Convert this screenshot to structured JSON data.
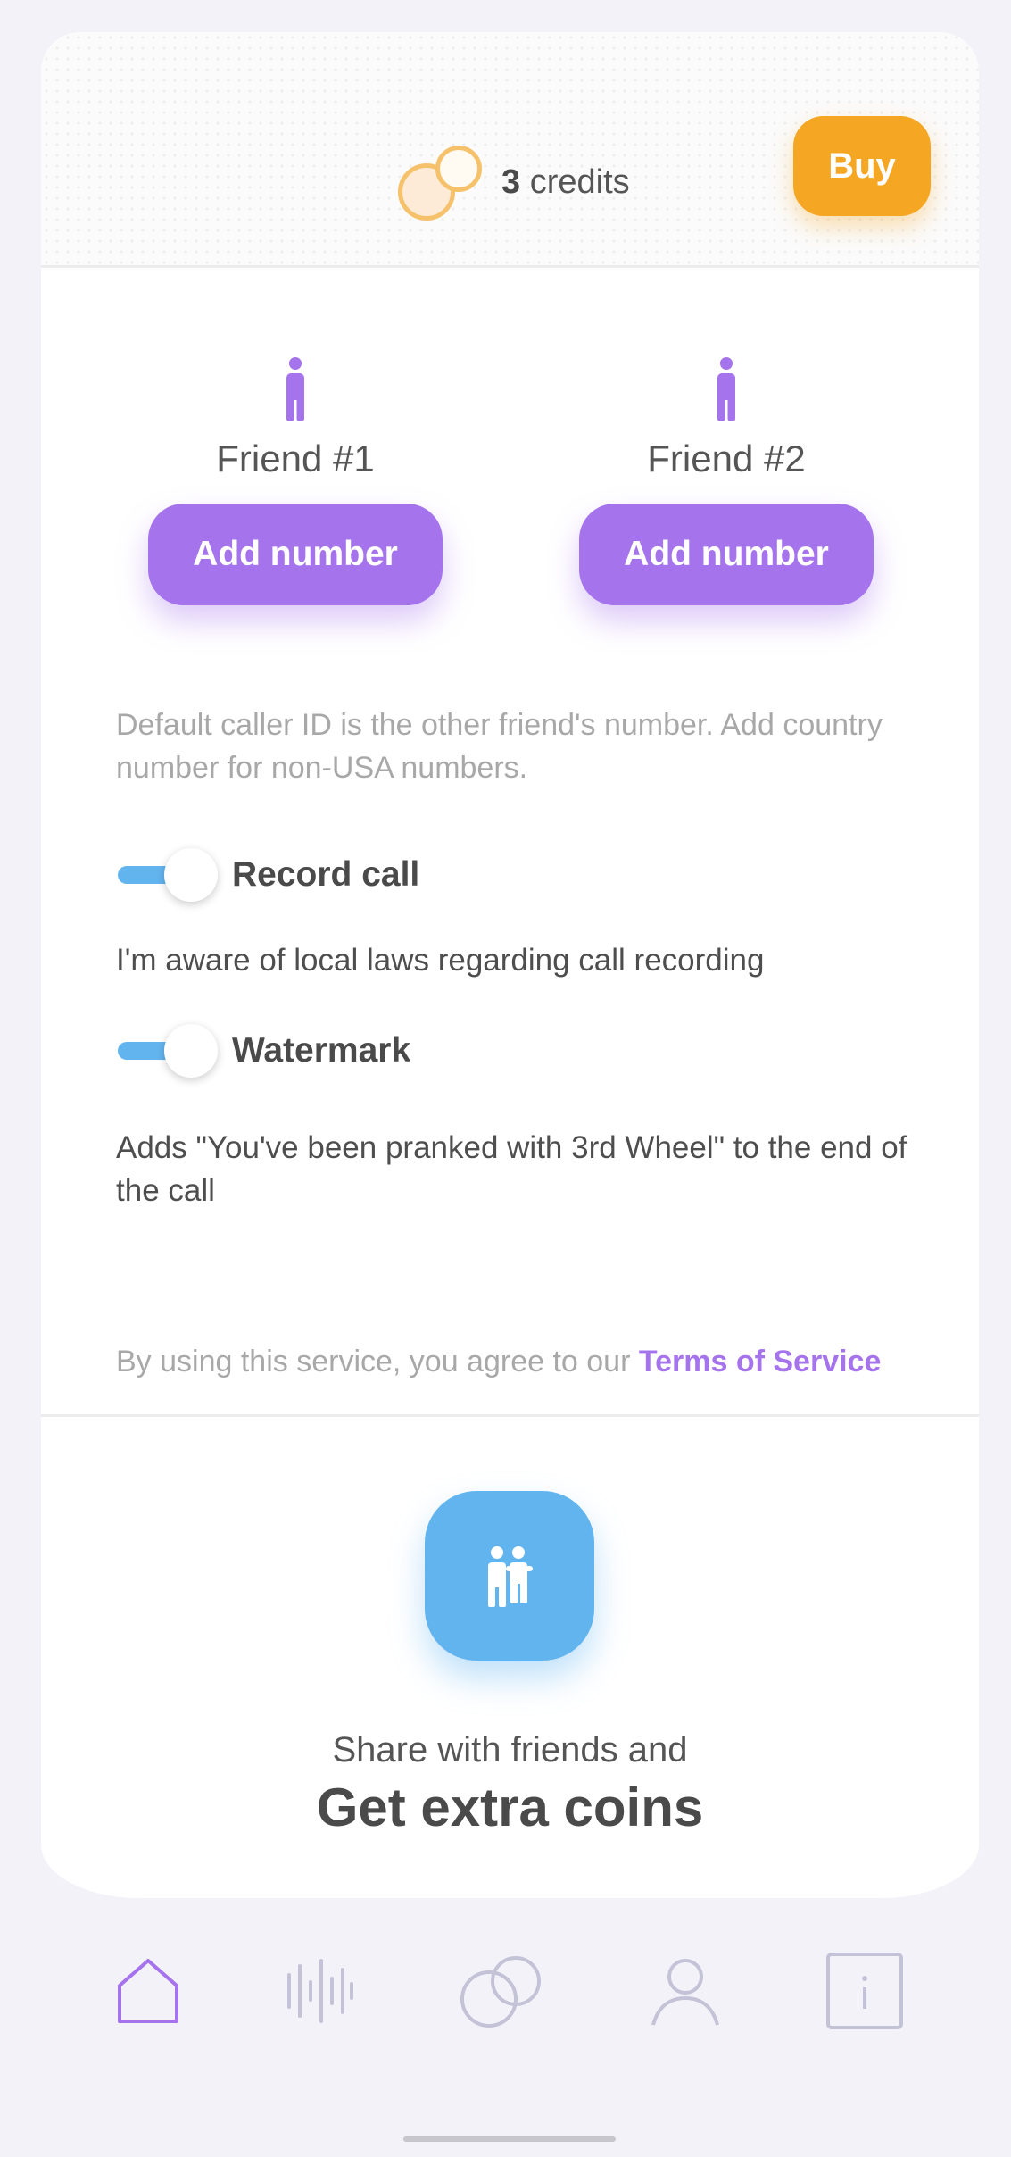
{
  "header": {
    "credits_count": "3",
    "credits_label": "credits",
    "buy_label": "Buy",
    "coin_icon": "coins-icon"
  },
  "friends": [
    {
      "label": "Friend #1",
      "button_label": "Add number",
      "icon": "person-icon"
    },
    {
      "label": "Friend #2",
      "button_label": "Add number",
      "icon": "person-icon"
    }
  ],
  "hint_text": "Default caller ID is the other friend's number. Add country number for non-USA numbers.",
  "options": {
    "record": {
      "label": "Record call",
      "description": "I'm aware of local laws regarding call recording",
      "enabled": true
    },
    "watermark": {
      "label": "Watermark",
      "description": "Adds \"You've been pranked with 3rd Wheel\" to the end of the call",
      "enabled": true
    }
  },
  "terms": {
    "prefix": "By using this service, you agree to our",
    "link": "Terms of Service"
  },
  "share": {
    "line1": "Share with friends and",
    "line2": "Get extra coins",
    "icon": "family-icon"
  },
  "bottom_nav": [
    {
      "icon": "home-icon",
      "active": true
    },
    {
      "icon": "soundwave-icon",
      "active": false
    },
    {
      "icon": "coins-icon",
      "active": false
    },
    {
      "icon": "profile-icon",
      "active": false
    },
    {
      "icon": "info-icon",
      "active": false
    }
  ],
  "colors": {
    "accent_purple": "#a574ec",
    "accent_orange": "#f5a623",
    "accent_blue": "#62b4ef",
    "nav_inactive": "#c4c2d6"
  }
}
